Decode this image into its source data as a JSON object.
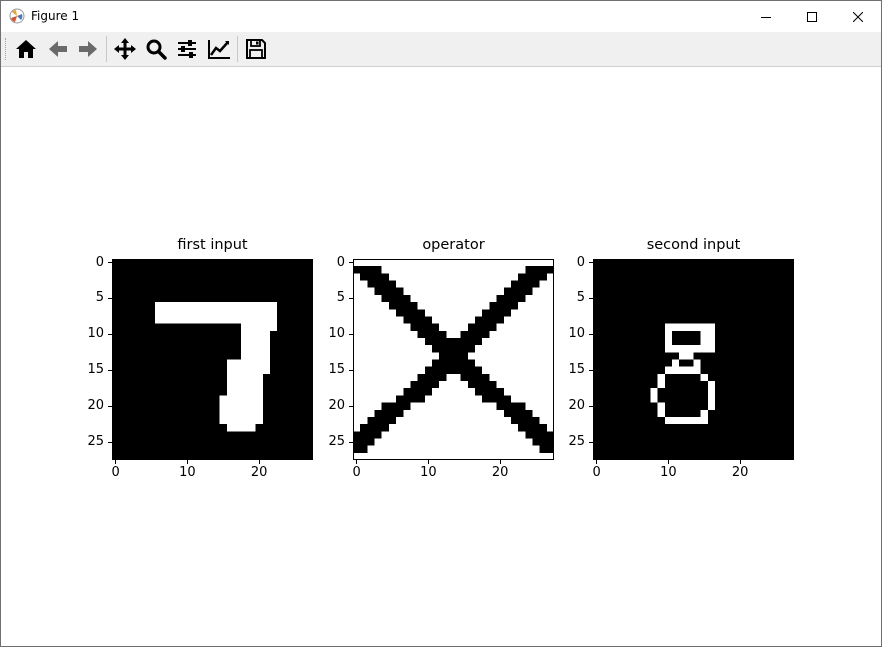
{
  "window": {
    "title": "Figure 1",
    "controls": [
      "minimize",
      "maximize",
      "close"
    ]
  },
  "toolbar": {
    "buttons": [
      {
        "name": "home",
        "icon": "home-icon"
      },
      {
        "name": "back",
        "icon": "arrow-left-icon"
      },
      {
        "name": "forward",
        "icon": "arrow-right-icon"
      },
      {
        "name": "pan",
        "icon": "move-icon"
      },
      {
        "name": "zoom",
        "icon": "magnifier-icon"
      },
      {
        "name": "configure-subplots",
        "icon": "sliders-icon"
      },
      {
        "name": "edit-axis",
        "icon": "line-chart-icon"
      },
      {
        "name": "save",
        "icon": "floppy-disk-icon"
      }
    ]
  },
  "colors": {
    "foreground": "#ffffff",
    "background": "#000000",
    "toolbar": "#f0f0f0"
  },
  "chart_data": [
    {
      "type": "heatmap",
      "title": "first input",
      "colormap": "gray",
      "shape": [
        28,
        28
      ],
      "yticks": [
        "0",
        "5",
        "10",
        "15",
        "20",
        "25"
      ],
      "xticks": [
        "0",
        "10",
        "20"
      ],
      "white_rect_cells": [
        {
          "row": 6,
          "cols": [
            6,
            22
          ]
        },
        {
          "row": 7,
          "cols": [
            6,
            22
          ]
        },
        {
          "row": 8,
          "cols": [
            6,
            22
          ]
        },
        {
          "row": 9,
          "cols": [
            18,
            22
          ]
        },
        {
          "row": 10,
          "cols": [
            18,
            21
          ]
        },
        {
          "row": 11,
          "cols": [
            18,
            21
          ]
        },
        {
          "row": 12,
          "cols": [
            18,
            21
          ]
        },
        {
          "row": 13,
          "cols": [
            18,
            21
          ]
        },
        {
          "row": 14,
          "cols": [
            16,
            21
          ]
        },
        {
          "row": 15,
          "cols": [
            16,
            21
          ]
        },
        {
          "row": 16,
          "cols": [
            16,
            20
          ]
        },
        {
          "row": 17,
          "cols": [
            16,
            20
          ]
        },
        {
          "row": 18,
          "cols": [
            16,
            20
          ]
        },
        {
          "row": 19,
          "cols": [
            15,
            20
          ]
        },
        {
          "row": 20,
          "cols": [
            15,
            20
          ]
        },
        {
          "row": 21,
          "cols": [
            15,
            20
          ]
        },
        {
          "row": 22,
          "cols": [
            15,
            20
          ]
        },
        {
          "row": 23,
          "cols": [
            16,
            19
          ]
        }
      ]
    },
    {
      "type": "heatmap",
      "title": "operator",
      "colormap": "gray",
      "shape": [
        28,
        28
      ],
      "yticks": [
        "0",
        "5",
        "10",
        "15",
        "20",
        "25"
      ],
      "xticks": [
        "0",
        "10",
        "20"
      ],
      "symbol": "X"
    },
    {
      "type": "heatmap",
      "title": "second input",
      "colormap": "gray",
      "shape": [
        28,
        28
      ],
      "yticks": [
        "0",
        "5",
        "10",
        "15",
        "20",
        "25"
      ],
      "xticks": [
        "0",
        "10",
        "20"
      ],
      "symbol": "8"
    }
  ]
}
